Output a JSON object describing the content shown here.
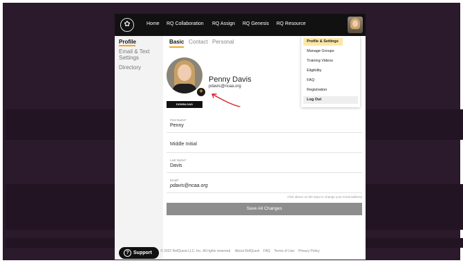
{
  "nav": {
    "items": [
      "Home",
      "RQ Collaboration",
      "RQ Assign",
      "RQ Genesis",
      "RQ Resource"
    ]
  },
  "sidebar": {
    "items": [
      {
        "label": "Profile"
      },
      {
        "label": "Email & Text Settings"
      },
      {
        "label": "Directory"
      }
    ]
  },
  "tabs": [
    "Basic",
    "Contact",
    "Personal"
  ],
  "profile": {
    "name": "Penny Davis",
    "email": "pdavis@ncaa.org",
    "download_label": "DOWNLOAD"
  },
  "form": {
    "first_name_label": "First Name*",
    "first_name_value": "Penny",
    "middle_initial_placeholder": "Middle Initial",
    "last_name_label": "Last Name*",
    "last_name_value": "Davis",
    "email_label": "Email*",
    "email_value": "pdavis@ncaa.org",
    "email_hint": "Click above on the input to change your email address",
    "save_label": "Save All Changes"
  },
  "dropdown": {
    "items": [
      "Profile & Settings",
      "Manage Groups",
      "Training Videos",
      "Eligibility",
      "FAQ",
      "Registration",
      "Log Out"
    ]
  },
  "footer": {
    "copyright": "© 2022 RefQuest LLC, Inc. All rights reserved.",
    "links": [
      "About RefQuest",
      "FAQ",
      "Terms of Use",
      "Privacy Policy"
    ]
  },
  "support": {
    "label": "Support"
  },
  "colors": {
    "accent": "#f5a623",
    "topbar": "#111111",
    "backdrop": "#2a1a2b"
  }
}
